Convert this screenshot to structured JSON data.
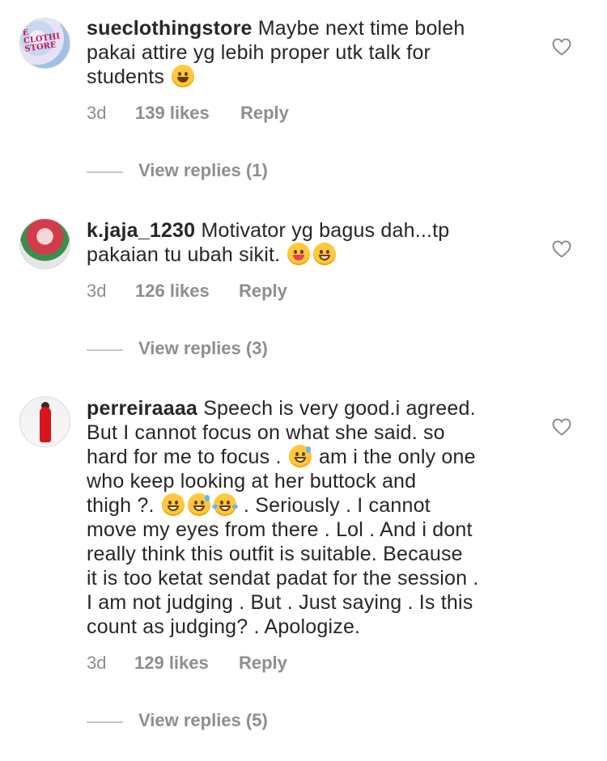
{
  "comments": [
    {
      "username": "sueclothingstore",
      "avatar_text": "E CLOTHI STORE",
      "line1": "Maybe next time boleh",
      "line2": "pakai attire yg lebih proper utk talk for",
      "line3": "students",
      "time": "3d",
      "likes": "139 likes",
      "reply": "Reply",
      "view_replies": "View replies (1)"
    },
    {
      "username": "k.jaja_1230",
      "line1": "Motivator yg bagus dah...tp",
      "line2": "pakaian tu ubah sikit.",
      "time": "3d",
      "likes": "126 likes",
      "reply": "Reply",
      "view_replies": "View replies (3)"
    },
    {
      "username": "perreiraaaa",
      "line1": "Speech is very good.i agreed.",
      "line2": "But I cannot focus on what she said.  so",
      "line3": "hard for me to focus .",
      "line3b": "am i the only one",
      "line4": "who keep looking at her buttock and",
      "line5": "thigh ?.",
      "line5b": ". Seriously . I cannot",
      "line6": "move my eyes from there . Lol . And i dont",
      "line7": "really think this outfit  is suitable. Because",
      "line8": "it is too ketat sendat padat for the  session .",
      "line9": "I am not judging . But . Just saying . Is this",
      "line10": "count as judging? . Apologize.",
      "time": "3d",
      "likes": "129 likes",
      "reply": "Reply",
      "view_replies": "View replies (5)"
    }
  ],
  "icons": {
    "like": "heart-outline-icon",
    "emoji_smile": "smiling-face-emoji",
    "emoji_yum": "face-savoring-food-emoji",
    "emoji_grin": "grinning-face-emoji",
    "emoji_sweat": "grinning-face-with-sweat-emoji",
    "emoji_squint": "grinning-squinting-face-emoji",
    "emoji_joy": "face-with-tears-of-joy-emoji"
  },
  "colors": {
    "text": "#262626",
    "muted": "#8e8e8e",
    "divider": "#c7c7c7",
    "emoji": "#ffc83d"
  }
}
